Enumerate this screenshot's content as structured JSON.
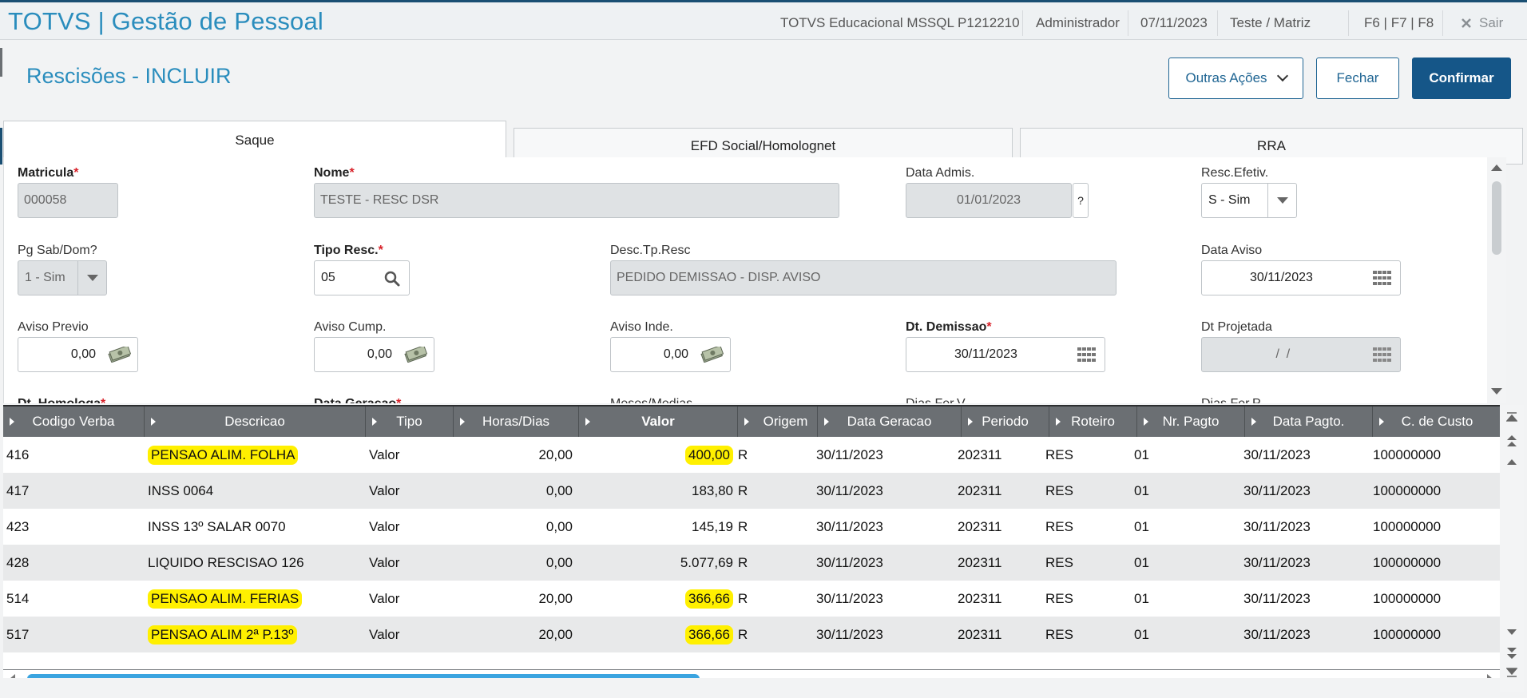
{
  "header": {
    "app_title": "TOTVS | Gestão de Pessoal",
    "environment": "TOTVS Educacional MSSQL P1212210",
    "user": "Administrador",
    "date": "07/11/2023",
    "branch": "Teste / Matriz",
    "shortcuts": "F6 | F7 | F8",
    "exit_label": "Sair"
  },
  "page": {
    "title": "Rescisões - INCLUIR",
    "actions": {
      "more": "Outras Ações",
      "close": "Fechar",
      "confirm": "Confirmar"
    }
  },
  "tabs": [
    "Saque",
    "EFD Social/Homolognet",
    "RRA"
  ],
  "form": {
    "matricula": {
      "label": "Matricula",
      "value": "000058"
    },
    "nome": {
      "label": "Nome",
      "value": "TESTE - RESC DSR"
    },
    "data_admis": {
      "label": "Data Admis.",
      "value": "01/01/2023",
      "help": "?"
    },
    "resc_efetiv": {
      "label": "Resc.Efetiv.",
      "value": "S - Sim"
    },
    "pg_sab_dom": {
      "label": "Pg Sab/Dom?",
      "value": "1 - Sim"
    },
    "tipo_resc": {
      "label": "Tipo Resc.",
      "value": "05"
    },
    "desc_tp_resc": {
      "label": "Desc.Tp.Resc",
      "value": "PEDIDO DEMISSAO - DISP. AVISO"
    },
    "data_aviso": {
      "label": "Data Aviso",
      "value": "30/11/2023"
    },
    "aviso_previo": {
      "label": "Aviso Previo",
      "value": "0,00"
    },
    "aviso_cump": {
      "label": "Aviso Cump.",
      "value": "0,00"
    },
    "aviso_inde": {
      "label": "Aviso Inde.",
      "value": "0,00"
    },
    "dt_demissao": {
      "label": "Dt. Demissao",
      "value": "30/11/2023"
    },
    "dt_projetada": {
      "label": "Dt Projetada",
      "value": " /  /"
    },
    "partial_labels": [
      "Dt. Homologa",
      "Data Geracao",
      "Meses/Medias",
      "Dias Fer.V",
      "Dias Fer.P"
    ],
    "required_mark": "*"
  },
  "grid": {
    "columns": [
      "Codigo Verba",
      "Descricao",
      "Tipo",
      "Horas/Dias",
      "Valor",
      "Origem",
      "Data Geracao",
      "Periodo",
      "Roteiro",
      "Nr. Pagto",
      "Data Pagto.",
      "C. de Custo"
    ],
    "rows": [
      {
        "codigo": "416",
        "descricao": "PENSAO ALIM. FOLHA",
        "tipo": "Valor",
        "horas": "20,00",
        "valor": "400,00",
        "origem": "R",
        "data_geracao": "30/11/2023",
        "periodo": "202311",
        "roteiro": "RES",
        "nr_pagto": "01",
        "data_pagto": "30/11/2023",
        "custo": "100000000"
      },
      {
        "codigo": "417",
        "descricao": "INSS 0064",
        "tipo": "Valor",
        "horas": "0,00",
        "valor": "183,80",
        "origem": "R",
        "data_geracao": "30/11/2023",
        "periodo": "202311",
        "roteiro": "RES",
        "nr_pagto": "01",
        "data_pagto": "30/11/2023",
        "custo": "100000000"
      },
      {
        "codigo": "423",
        "descricao": "INSS 13º SALAR 0070",
        "tipo": "Valor",
        "horas": "0,00",
        "valor": "145,19",
        "origem": "R",
        "data_geracao": "30/11/2023",
        "periodo": "202311",
        "roteiro": "RES",
        "nr_pagto": "01",
        "data_pagto": "30/11/2023",
        "custo": "100000000"
      },
      {
        "codigo": "428",
        "descricao": "LIQUIDO RESCISAO 126",
        "tipo": "Valor",
        "horas": "0,00",
        "valor": "5.077,69",
        "origem": "R",
        "data_geracao": "30/11/2023",
        "periodo": "202311",
        "roteiro": "RES",
        "nr_pagto": "01",
        "data_pagto": "30/11/2023",
        "custo": "100000000"
      },
      {
        "codigo": "514",
        "descricao": "PENSAO ALIM. FERIAS",
        "tipo": "Valor",
        "horas": "20,00",
        "valor": "366,66",
        "origem": "R",
        "data_geracao": "30/11/2023",
        "periodo": "202311",
        "roteiro": "RES",
        "nr_pagto": "01",
        "data_pagto": "30/11/2023",
        "custo": "100000000"
      },
      {
        "codigo": "517",
        "descricao": "PENSAO ALIM 2ª P.13º",
        "tipo": "Valor",
        "horas": "20,00",
        "valor": "366,66",
        "origem": "R",
        "data_geracao": "30/11/2023",
        "periodo": "202311",
        "roteiro": "RES",
        "nr_pagto": "01",
        "data_pagto": "30/11/2023",
        "custo": "100000000"
      }
    ],
    "highlighted_rows": [
      0,
      4,
      5
    ],
    "highlight_color": "#fff000"
  },
  "colors": {
    "brand": "#2a8dbd",
    "primary_button": "#155688",
    "header_grid": "#6b6f73",
    "scroll_thumb": "#3aa4e0"
  }
}
